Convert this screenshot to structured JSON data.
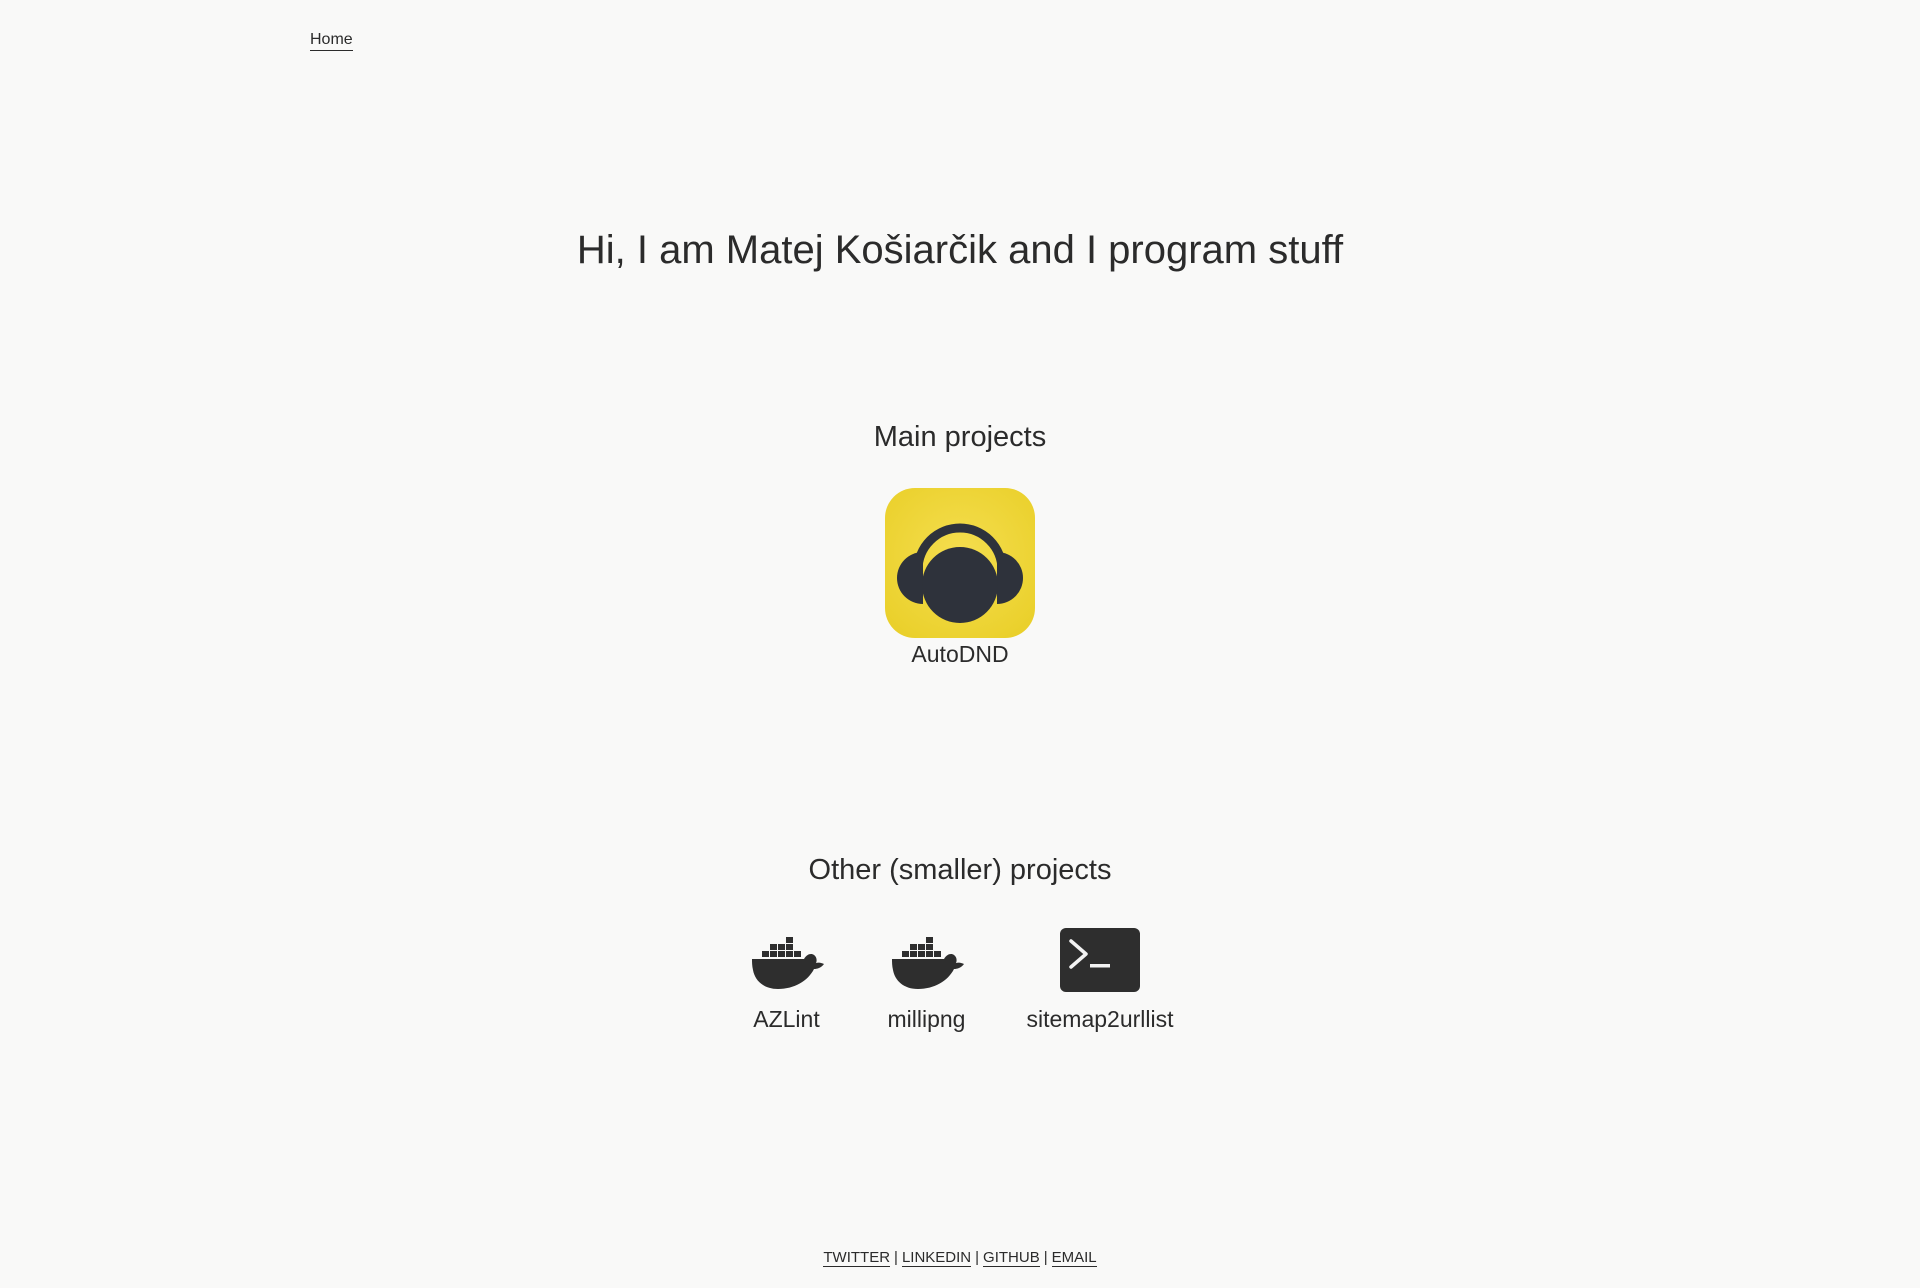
{
  "nav": {
    "home_label": "Home"
  },
  "hero": {
    "title": "Hi, I am Matej Košiarčik and I program stuff"
  },
  "main_projects": {
    "title": "Main projects",
    "items": [
      {
        "label": "AutoDND",
        "icon": "headphones-app-icon",
        "icon_bg": "#f0d43a",
        "icon_fg": "#2e323b"
      }
    ]
  },
  "other_projects": {
    "title": "Other (smaller) projects",
    "items": [
      {
        "label": "AZLint",
        "icon": "docker-whale-icon"
      },
      {
        "label": "millipng",
        "icon": "docker-whale-icon"
      },
      {
        "label": "sitemap2urllist",
        "icon": "terminal-icon"
      }
    ]
  },
  "footer": {
    "links": [
      "TWITTER",
      "LINKEDIN",
      "GITHUB",
      "EMAIL"
    ],
    "separator": "|"
  },
  "colors": {
    "background": "#f9f9f8",
    "text": "#2b2b2b"
  }
}
